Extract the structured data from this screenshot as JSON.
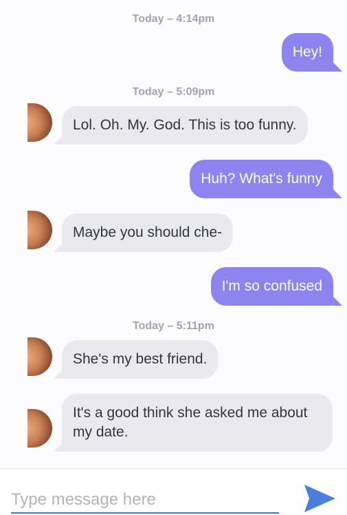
{
  "timestamps": {
    "t1": "Today – 4:14pm",
    "t2": "Today – 5:09pm",
    "t3": "Today – 5:11pm"
  },
  "messages": [
    {
      "direction": "outgoing",
      "text": "Hey!"
    },
    {
      "direction": "incoming",
      "text": "Lol. Oh. My. God. This is too funny."
    },
    {
      "direction": "outgoing",
      "text": "Huh? What's funny"
    },
    {
      "direction": "incoming",
      "text": "Maybe you should che-"
    },
    {
      "direction": "outgoing",
      "text": "I'm so confused"
    },
    {
      "direction": "incoming",
      "text": "She's my best friend."
    },
    {
      "direction": "incoming",
      "text": "It's a good think she asked me about my date."
    }
  ],
  "composer": {
    "placeholder": "Type message here",
    "value": ""
  },
  "icons": {
    "avatar": "contact-avatar",
    "send": "send-icon"
  },
  "colors": {
    "outgoing_bubble": "#8d84ef",
    "incoming_bubble": "#e9e9ee",
    "send_icon": "#4a7fe0",
    "input_underline": "#3d77d4"
  }
}
